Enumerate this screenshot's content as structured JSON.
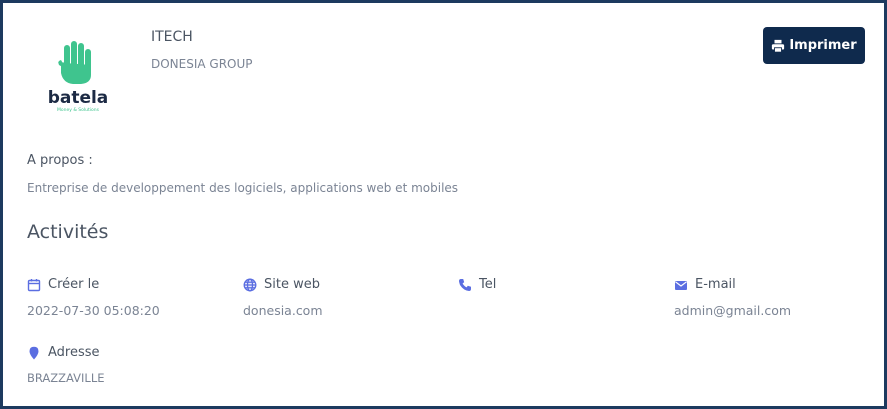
{
  "company": {
    "logo_text": "batela",
    "logo_tagline": "Money & Solutions",
    "name": "ITECH",
    "group": "DONESIA GROUP"
  },
  "actions": {
    "print_label": "Imprimer"
  },
  "about": {
    "label": "A propos :",
    "text": "Entreprise de developpement des logiciels, applications web et mobiles"
  },
  "activities": {
    "title": "Activités",
    "created": {
      "label": "Créer le",
      "value": "2022-07-30 05:08:20",
      "icon": "calendar-icon"
    },
    "website": {
      "label": "Site web",
      "value": "donesia.com",
      "icon": "globe-icon"
    },
    "tel": {
      "label": "Tel",
      "value": "",
      "icon": "phone-icon"
    },
    "email": {
      "label": "E-mail",
      "value": "admin@gmail.com",
      "icon": "envelope-icon"
    },
    "address": {
      "label": "Adresse",
      "value": "BRAZZAVILLE",
      "icon": "map-marker-icon"
    }
  },
  "colors": {
    "accent": "#5b6ee1",
    "button": "#0f2a4d",
    "border": "#1d3a5f",
    "logo_hand": "#3fc48e"
  }
}
